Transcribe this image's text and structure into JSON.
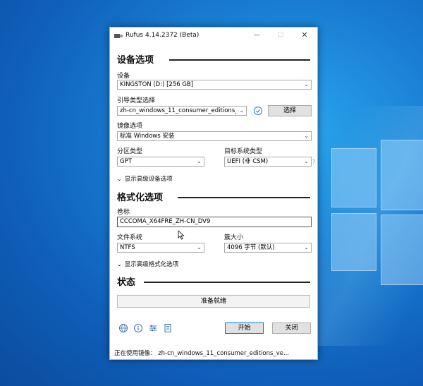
{
  "window": {
    "title": "Rufus 4.14.2372 (Beta)"
  },
  "titlebar": {
    "minimize": "—",
    "maximize": "☐",
    "close": "✕"
  },
  "sections": {
    "device_options": "设备选项",
    "format_options": "格式化选项",
    "status": "状态"
  },
  "device": {
    "label": "设备",
    "value": "KINGSTON (D:) [256 GB]"
  },
  "boot": {
    "label": "引导类型选择",
    "value": "zh-cn_windows_11_consumer_editions_ve",
    "select_button": "选择"
  },
  "image_option": {
    "label": "镜像选项",
    "value": "标准 Windows 安装"
  },
  "partition": {
    "label": "分区类型",
    "value": "GPT"
  },
  "target": {
    "label": "目标系统类型",
    "value": "UEFI (非 CSM)",
    "help": "?"
  },
  "advanced_device": {
    "label": "显示高级设备选项"
  },
  "volume": {
    "label": "卷标",
    "value": "CCCOMA_X64FRE_ZH-CN_DV9"
  },
  "filesystem": {
    "label": "文件系统",
    "value": "NTFS"
  },
  "cluster": {
    "label": "簇大小",
    "value": "4096 字节 (默认)"
  },
  "advanced_format": {
    "label": "显示高级格式化选项"
  },
  "status_text": "准备就绪",
  "buttons": {
    "start": "开始",
    "close": "关闭"
  },
  "footer": {
    "text": "正在使用镜像： zh-cn_windows_11_consumer_editions_ve..."
  },
  "icons": [
    "globe-icon",
    "info-icon",
    "settings-sliders-icon",
    "log-icon"
  ],
  "colors": {
    "desktop": "#1a7fd4",
    "accent": "#0078d7",
    "check": "#4a90d9"
  }
}
